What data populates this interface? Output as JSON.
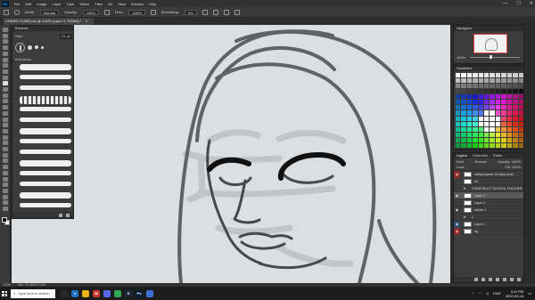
{
  "app": {
    "logo": "Ps",
    "menu": [
      "File",
      "Edit",
      "Image",
      "Layer",
      "Type",
      "Select",
      "Filter",
      "3D",
      "View",
      "Window",
      "Help"
    ],
    "window_controls": [
      "—",
      "☐",
      "✕"
    ]
  },
  "options_bar": {
    "mode_label": "Mode:",
    "mode_value": "Normal",
    "opacity_label": "Opacity:",
    "opacity_value": "100%",
    "flow_label": "Flow:",
    "flow_value": "100%",
    "smoothing_label": "Smoothing:",
    "smoothing_value": "0%"
  },
  "document": {
    "tab_title": "CHARM COMP.psd @ 100% (Layer 2, RGB/8) *",
    "close_glyph": "✕"
  },
  "tools": {
    "count": 31,
    "active_index": 9
  },
  "brushes_panel": {
    "title": "Brushes",
    "size_label": "Size:",
    "size_value": "21 px",
    "folder_label": "Brushes",
    "stroke_count": 14
  },
  "navigator": {
    "title": "Navigator",
    "zoom": "100%"
  },
  "swatches": {
    "title": "Swatches"
  },
  "layers_panel": {
    "tabs": [
      "Layers",
      "Channels",
      "Paths"
    ],
    "filter_label": "Kind",
    "blend_mode": "Normal",
    "opacity_label": "Opacity: 100%",
    "lock_label": "Lock:",
    "fill_label": "Fill: 100%",
    "layers": [
      {
        "name": "default gamer kit (wip) pixel",
        "visible": true,
        "eye_style": "red",
        "type": "layer"
      },
      {
        "name": "ref",
        "visible": false,
        "eye_style": "normal",
        "type": "layer"
      },
      {
        "name": "CONSTRUCT SCHOOL TEACHER",
        "visible": false,
        "eye_style": "normal",
        "type": "folder"
      },
      {
        "name": "Layer 2",
        "visible": true,
        "eye_style": "normal",
        "type": "layer",
        "selected": true
      },
      {
        "name": "Layer 4",
        "visible": false,
        "eye_style": "normal",
        "type": "layer"
      },
      {
        "name": "sketch 1",
        "visible": true,
        "eye_style": "normal",
        "type": "layer"
      },
      {
        "name": "1",
        "visible": false,
        "eye_style": "normal",
        "type": "folder"
      },
      {
        "name": "Layer 1",
        "visible": true,
        "eye_style": "blue",
        "type": "layer"
      },
      {
        "name": "bg",
        "visible": true,
        "eye_style": "red",
        "type": "layer"
      }
    ]
  },
  "status_bar": {
    "zoom": "100%",
    "doc_info": "Doc: 23.4M/127.2M"
  },
  "taskbar": {
    "search_placeholder": "Type here to search",
    "apps": [
      {
        "label": "",
        "color": "#2a2a2a"
      },
      {
        "label": "e",
        "color": "#1f6fc2"
      },
      {
        "label": "",
        "color": "#e8b31a"
      },
      {
        "label": "M",
        "color": "#c83b2e"
      },
      {
        "label": "",
        "color": "#5865f2"
      },
      {
        "label": "",
        "color": "#34a853"
      },
      {
        "label": "S",
        "color": "#1b2838"
      },
      {
        "label": "Ps",
        "color": "#001e36"
      },
      {
        "label": "",
        "color": "#3b6fd6"
      }
    ],
    "tray_lang": "ENG",
    "time": "3:11 PM",
    "date": "2022-03-16"
  }
}
